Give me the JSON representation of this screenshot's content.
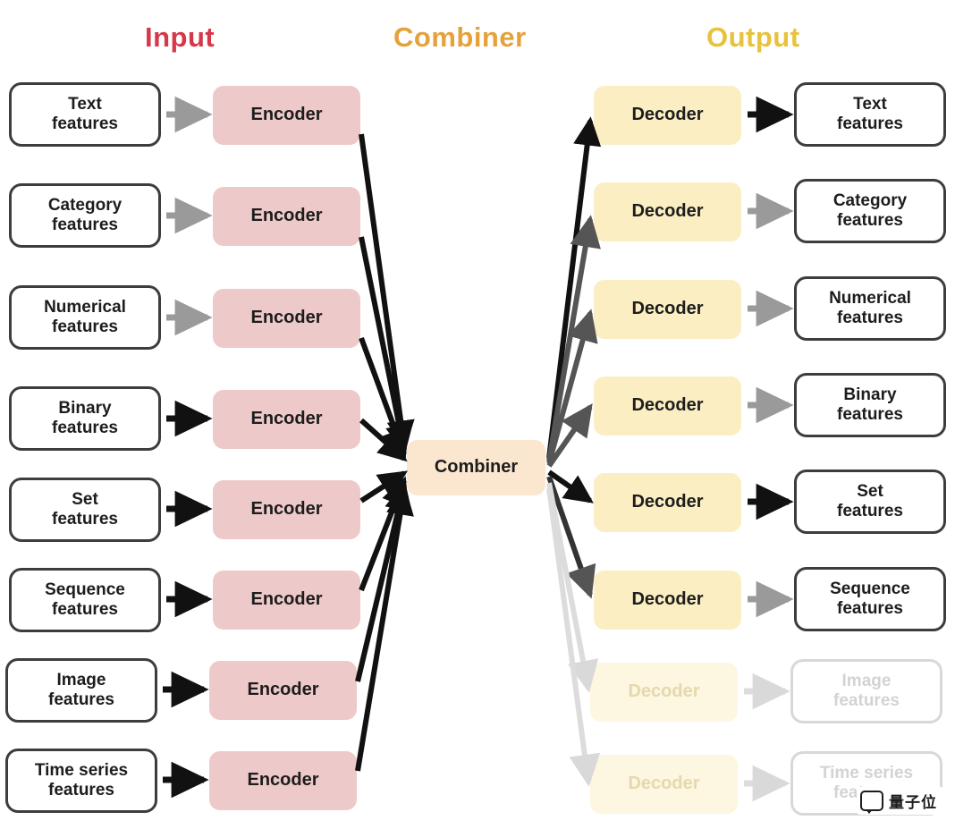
{
  "titles": {
    "input": "Input",
    "combiner": "Combiner",
    "output": "Output"
  },
  "colors": {
    "input_title": "#d6384a",
    "combiner_title": "#e5a13b",
    "output_title": "#e8c23c",
    "encoder_fill": "#eec9c9",
    "decoder_fill": "#fbeec2",
    "combiner_fill": "#fbe7cf",
    "box_outline": "#3d3d3d",
    "faded_outline": "#d8d8d8",
    "arrow_dark": "#111111",
    "arrow_mid": "#555555",
    "arrow_light": "#d9d9d9"
  },
  "labels": {
    "encoder": "Encoder",
    "decoder": "Decoder",
    "combiner": "Combiner"
  },
  "input_features": [
    {
      "line1": "Text",
      "line2": "features",
      "faded": false
    },
    {
      "line1": "Category",
      "line2": "features",
      "faded": false
    },
    {
      "line1": "Numerical",
      "line2": "features",
      "faded": false
    },
    {
      "line1": "Binary",
      "line2": "features",
      "faded": false
    },
    {
      "line1": "Set",
      "line2": "features",
      "faded": false
    },
    {
      "line1": "Sequence",
      "line2": "features",
      "faded": false
    },
    {
      "line1": "Image",
      "line2": "features",
      "faded": false
    },
    {
      "line1": "Time series",
      "line2": "features",
      "faded": false
    }
  ],
  "output_features": [
    {
      "line1": "Text",
      "line2": "features",
      "faded": false
    },
    {
      "line1": "Category",
      "line2": "features",
      "faded": false
    },
    {
      "line1": "Numerical",
      "line2": "features",
      "faded": false
    },
    {
      "line1": "Binary",
      "line2": "features",
      "faded": false
    },
    {
      "line1": "Set",
      "line2": "features",
      "faded": false
    },
    {
      "line1": "Sequence",
      "line2": "features",
      "faded": false
    },
    {
      "line1": "Image",
      "line2": "features",
      "faded": true
    },
    {
      "line1": "Time series",
      "line2": "features",
      "faded": true
    }
  ],
  "encoders": [
    {
      "label": "Encoder",
      "faded": false
    },
    {
      "label": "Encoder",
      "faded": false
    },
    {
      "label": "Encoder",
      "faded": false
    },
    {
      "label": "Encoder",
      "faded": false
    },
    {
      "label": "Encoder",
      "faded": false
    },
    {
      "label": "Encoder",
      "faded": false
    },
    {
      "label": "Encoder",
      "faded": false
    },
    {
      "label": "Encoder",
      "faded": false
    }
  ],
  "decoders": [
    {
      "label": "Decoder",
      "faded": false
    },
    {
      "label": "Decoder",
      "faded": false
    },
    {
      "label": "Decoder",
      "faded": false
    },
    {
      "label": "Decoder",
      "faded": false
    },
    {
      "label": "Decoder",
      "faded": false
    },
    {
      "label": "Decoder",
      "faded": false
    },
    {
      "label": "Decoder",
      "faded": true
    },
    {
      "label": "Decoder",
      "faded": true
    }
  ],
  "watermark": {
    "text": "量子位"
  }
}
